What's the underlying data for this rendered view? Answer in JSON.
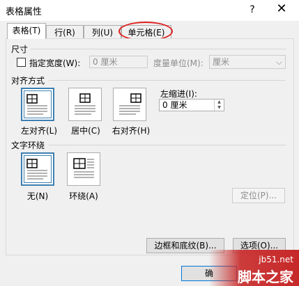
{
  "window": {
    "title": "表格属性",
    "help_symbol": "?",
    "close_symbol": "✕"
  },
  "tabs": [
    {
      "label": "表格(T)",
      "active": true
    },
    {
      "label": "行(R)",
      "active": false
    },
    {
      "label": "列(U)",
      "active": false
    },
    {
      "label": "单元格(E)",
      "active": false,
      "highlighted": true
    }
  ],
  "size_section": {
    "heading": "尺寸",
    "specify_width_label": "指定宽度(W):",
    "specify_width_checked": false,
    "width_value": "0 厘米",
    "unit_label": "度量单位(M):",
    "unit_value": "厘米"
  },
  "alignment_section": {
    "heading": "对齐方式",
    "options": [
      {
        "label": "左对齐(L)",
        "selected": true
      },
      {
        "label": "居中(C)",
        "selected": false
      },
      {
        "label": "右对齐(H)",
        "selected": false
      }
    ],
    "indent_label": "左缩进(I):",
    "indent_value": "0 厘米"
  },
  "wrap_section": {
    "heading": "文字环绕",
    "options": [
      {
        "label": "无(N)",
        "selected": true
      },
      {
        "label": "环绕(A)",
        "selected": false
      }
    ],
    "position_button": "定位(P)..."
  },
  "buttons": {
    "borders_label": "边框和底纹(B)...",
    "options_label": "选项(O)...",
    "ok_label": "确"
  },
  "watermark": {
    "site": "jb51.net",
    "name": "脚本之家"
  },
  "colors": {
    "highlight_circle": "#e02020",
    "selection_border": "#3c7fb1",
    "watermark_band": "#c62828"
  }
}
